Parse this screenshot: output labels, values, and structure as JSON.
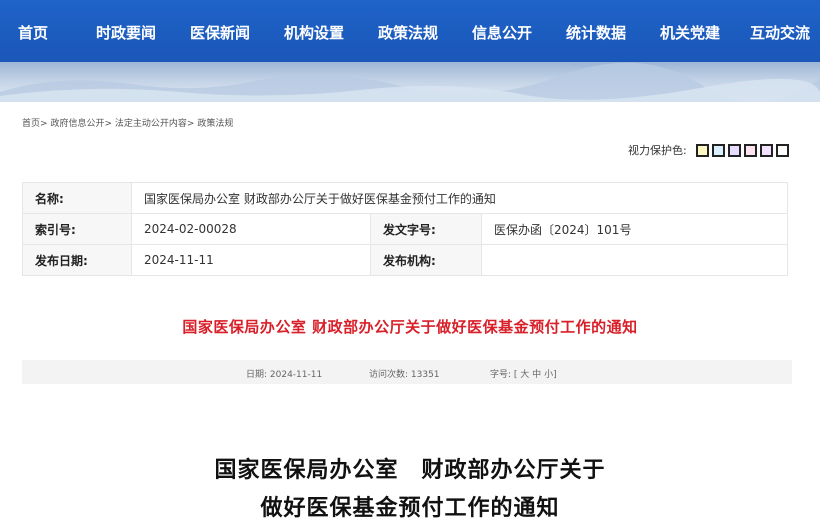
{
  "nav": {
    "items": [
      "首页",
      "时政要闻",
      "医保新闻",
      "机构设置",
      "政策法规",
      "信息公开",
      "统计数据",
      "机关党建",
      "互动交流"
    ]
  },
  "breadcrumb": {
    "items": [
      "首页",
      "政府信息公开",
      "法定主动公开内容",
      "政策法规"
    ],
    "separator": ">"
  },
  "vision": {
    "label": "视力保护色:",
    "swatches": [
      "#fdf7c3",
      "#d8f0ff",
      "#e6dcff",
      "#ffe3ef",
      "#f3e2ff",
      "#ffffff"
    ]
  },
  "info": {
    "name_label": "名称:",
    "name_value": "国家医保局办公室 财政部办公厅关于做好医保基金预付工作的通知",
    "index_label": "索引号:",
    "index_value": "2024-02-00028",
    "doc_no_label": "发文字号:",
    "doc_no_value": "医保办函〔2024〕101号",
    "date_label": "发布日期:",
    "date_value": "2024-11-11",
    "org_label": "发布机构:",
    "org_value": ""
  },
  "article": {
    "red_title": "国家医保局办公室 财政部办公厅关于做好医保基金预付工作的通知",
    "meta_date": "日期: 2024-11-11",
    "meta_visits": "访问次数: 13351",
    "meta_size_prefix": "字号: [",
    "meta_size_large": "大",
    "meta_size_medium": "中",
    "meta_size_small": "小",
    "meta_size_suffix": "]",
    "title_line1": "国家医保局办公室　财政部办公厅关于",
    "title_line2": "做好医保基金预付工作的通知"
  },
  "colors": {
    "nav_bg": "#1f63c9",
    "red_title": "#d9202a"
  }
}
